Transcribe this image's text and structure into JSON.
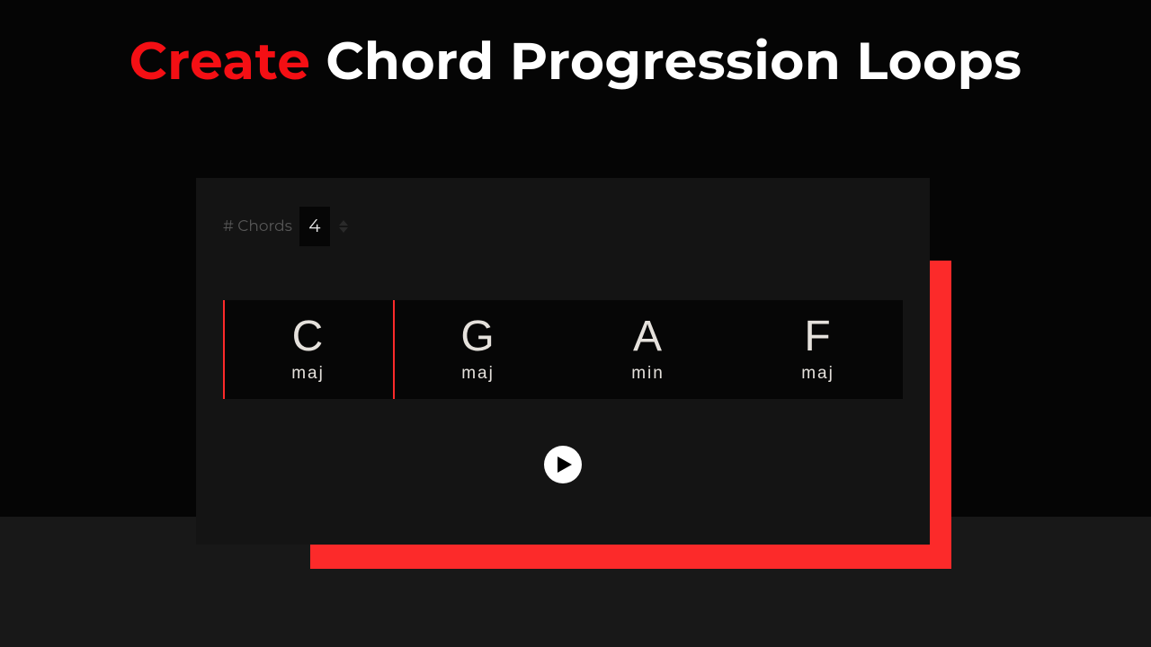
{
  "heading": {
    "accent": "Create",
    "rest": " Chord Progression Loops"
  },
  "countLabel": "# Chords",
  "countValue": "4",
  "chords": [
    {
      "root": "C",
      "quality": "maj"
    },
    {
      "root": "G",
      "quality": "maj"
    },
    {
      "root": "A",
      "quality": "min"
    },
    {
      "root": "F",
      "quality": "maj"
    }
  ],
  "selectedIndex": 0,
  "colors": {
    "accent": "#fc2a2a",
    "headingAccent": "#f40f14"
  }
}
